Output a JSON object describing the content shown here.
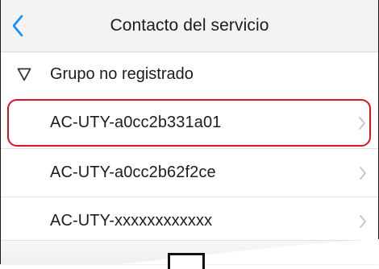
{
  "navbar": {
    "title": "Contacto del servicio",
    "back_icon": "chevron-left-icon",
    "accent_color": "#1a8cff"
  },
  "group": {
    "label": "Grupo no registrado",
    "icon": "triangle-down-icon",
    "expanded": true
  },
  "devices": [
    {
      "label": "AC-UTY-a0cc2b331a01",
      "highlighted": true
    },
    {
      "label": "AC-UTY-a0cc2b62f2ce",
      "highlighted": false
    },
    {
      "label": "AC-UTY-xxxxxxxxxxxx",
      "highlighted": false
    }
  ],
  "highlight_color": "#d8151c",
  "row_icon": "chevron-right-icon"
}
